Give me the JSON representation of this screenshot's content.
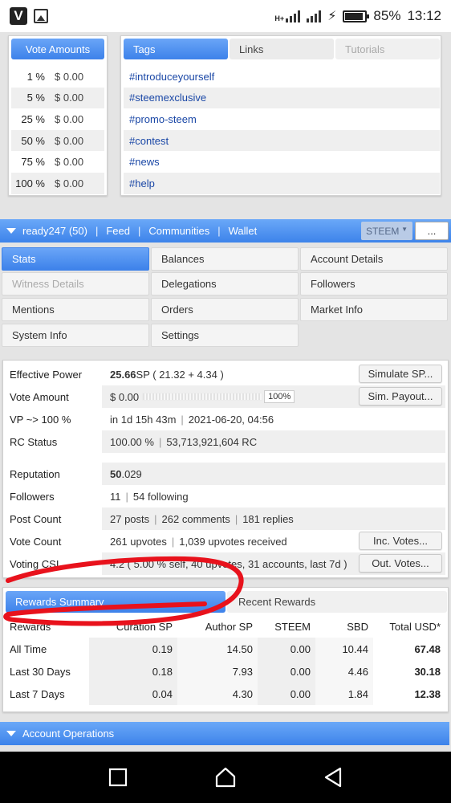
{
  "status_bar": {
    "network": "H+",
    "battery": "85%",
    "time": "13:12",
    "app_icon_letter": "V"
  },
  "vote_amounts": {
    "header": "Vote Amounts",
    "rows": [
      {
        "pct": "1 %",
        "amount": "$ 0.00"
      },
      {
        "pct": "5 %",
        "amount": "$ 0.00"
      },
      {
        "pct": "25 %",
        "amount": "$ 0.00"
      },
      {
        "pct": "50 %",
        "amount": "$ 0.00"
      },
      {
        "pct": "75 %",
        "amount": "$ 0.00"
      },
      {
        "pct": "100 %",
        "amount": "$ 0.00"
      }
    ]
  },
  "tags_panel": {
    "tabs": [
      "Tags",
      "Links",
      "Tutorials"
    ],
    "tags": [
      "#introduceyourself",
      "#steemexclusive",
      "#promo-steem",
      "#contest",
      "#news",
      "#help"
    ]
  },
  "user_bar": {
    "account": "ready247 (50)",
    "links": [
      "Feed",
      "Communities",
      "Wallet"
    ],
    "currency": "STEEM",
    "more_label": "..."
  },
  "nav": {
    "stats": "Stats",
    "balances": "Balances",
    "account_details": "Account Details",
    "witness_details": "Witness Details",
    "delegations": "Delegations",
    "followers": "Followers",
    "mentions": "Mentions",
    "orders": "Orders",
    "market_info": "Market Info",
    "system_info": "System Info",
    "settings": "Settings"
  },
  "stats": {
    "effective_power": {
      "label": "Effective Power",
      "value_bold": "25.66",
      "value_rest": " SP ( 21.32 + 4.34 )",
      "button": "Simulate SP..."
    },
    "vote_amount": {
      "label": "Vote Amount",
      "value": "$ 0.00",
      "slider_pct": "100%",
      "button": "Sim. Payout..."
    },
    "vp": {
      "label": "VP ~> 100 %",
      "value_a": "in 1d 15h 43m",
      "value_b": "2021-06-20, 04:56"
    },
    "rc": {
      "label": "RC Status",
      "value_a": "100.00 %",
      "value_b": "53,713,921,604 RC"
    },
    "reputation": {
      "label": "Reputation",
      "value_bold": "50",
      "value_rest": ".029"
    },
    "followers": {
      "label": "Followers",
      "value_a": "11",
      "value_b": "54 following"
    },
    "post_count": {
      "label": "Post Count",
      "value_a": "27 posts",
      "value_b": "262 comments",
      "value_c": "181 replies"
    },
    "vote_count": {
      "label": "Vote Count",
      "value_a": "261 upvotes",
      "value_b": "1,039 upvotes received",
      "button": "Inc. Votes..."
    },
    "voting_csi": {
      "label": "Voting CSI",
      "value": "4.2 ( 5.00 % self, 40 upvotes, 31 accounts, last 7d )",
      "button": "Out. Votes..."
    }
  },
  "rewards": {
    "tabs": [
      "Rewards Summary",
      "Recent Rewards"
    ],
    "columns": [
      "Rewards",
      "Curation SP",
      "Author SP",
      "STEEM",
      "SBD",
      "Total USD*"
    ],
    "rows": [
      {
        "period": "All Time",
        "curation": "0.19",
        "author": "14.50",
        "steem": "0.00",
        "sbd": "10.44",
        "total": "67.48"
      },
      {
        "period": "Last 30 Days",
        "curation": "0.18",
        "author": "7.93",
        "steem": "0.00",
        "sbd": "4.46",
        "total": "30.18"
      },
      {
        "period": "Last 7 Days",
        "curation": "0.04",
        "author": "4.30",
        "steem": "0.00",
        "sbd": "1.84",
        "total": "12.38"
      }
    ]
  },
  "account_operations": "Account Operations",
  "colors": {
    "accent_blue": "#3d82ea",
    "link_blue": "#1a47a6",
    "annotation_red": "#e8121c"
  }
}
